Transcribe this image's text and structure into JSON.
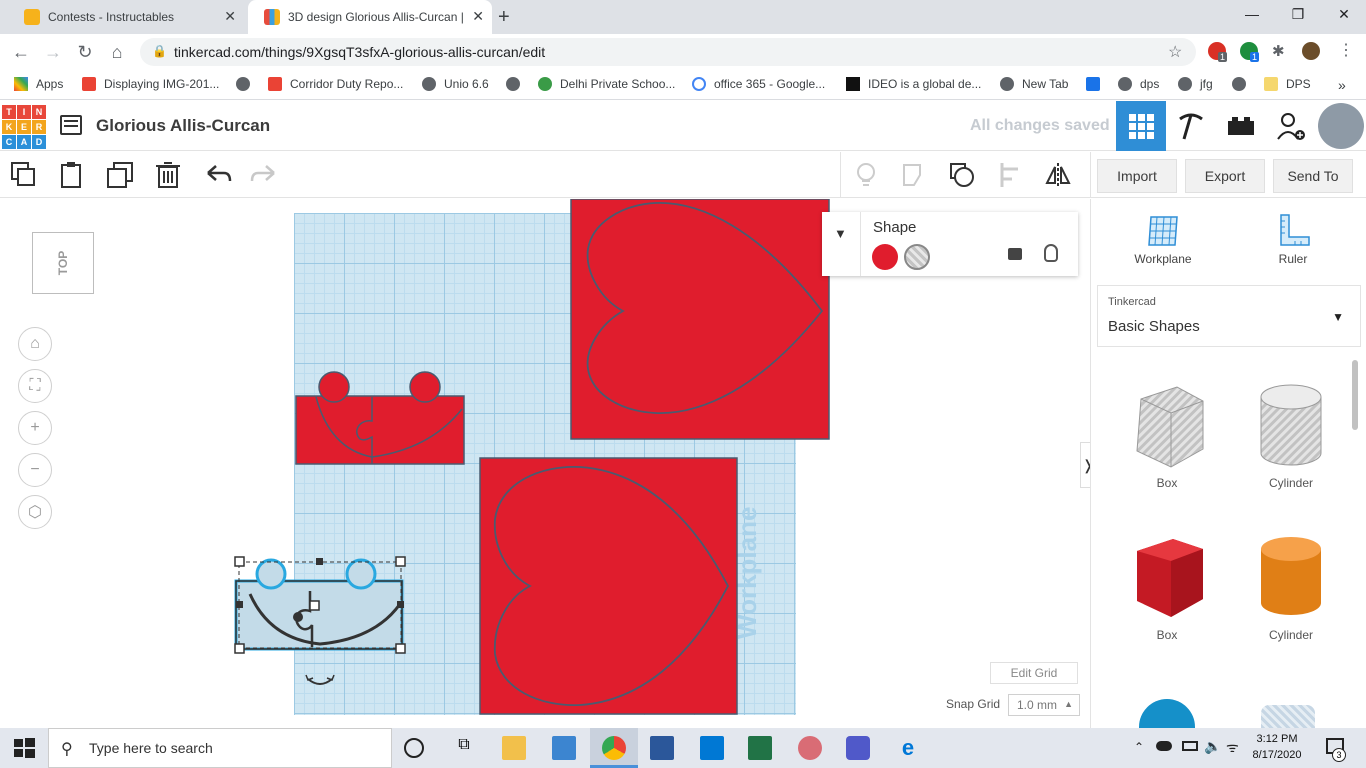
{
  "browser": {
    "tabs": [
      {
        "title": "Contests - Instructables",
        "active": false
      },
      {
        "title": "3D design Glorious Allis-Curcan |",
        "active": true
      }
    ],
    "url": "tinkercad.com/things/9XgsqT3sfxA-glorious-allis-curcan/edit",
    "bookmarks": [
      "Apps",
      "Displaying IMG-201...",
      "Corridor Duty Repo...",
      "Unio 6.6",
      "Delhi Private Schoo...",
      "office 365 - Google...",
      "IDEO is a global de...",
      "New Tab",
      "dps",
      "jfg",
      "DPS"
    ],
    "extension_badges": [
      "1",
      "1"
    ]
  },
  "app": {
    "logo_letters": [
      "T",
      "I",
      "N",
      "K",
      "E",
      "R",
      "C",
      "A",
      "D"
    ],
    "design_title": "Glorious Allis-Curcan",
    "save_status": "All changes saved"
  },
  "actions": {
    "import": "Import",
    "export": "Export",
    "send_to": "Send To"
  },
  "view": {
    "cube_label": "TOP",
    "workplane_label": "Workplane"
  },
  "shape_panel": {
    "title": "Shape",
    "solid_color": "#e01d2d"
  },
  "grid_controls": {
    "edit_grid": "Edit Grid",
    "snap_label": "Snap Grid",
    "snap_value": "1.0 mm"
  },
  "right_panel": {
    "tools": [
      "Workplane",
      "Ruler"
    ],
    "library_source": "Tinkercad",
    "library_name": "Basic Shapes",
    "shapes": [
      {
        "label": "Box",
        "kind": "hole"
      },
      {
        "label": "Cylinder",
        "kind": "hole"
      },
      {
        "label": "Box",
        "kind": "solid"
      },
      {
        "label": "Cylinder",
        "kind": "solid"
      }
    ]
  },
  "taskbar": {
    "search_placeholder": "Type here to search",
    "time": "3:12 PM",
    "date": "8/17/2020",
    "notification_count": "3"
  },
  "colors": {
    "red": "#e01d2d",
    "grid": "#cfe6f2",
    "accent": "#2f8ed6"
  }
}
